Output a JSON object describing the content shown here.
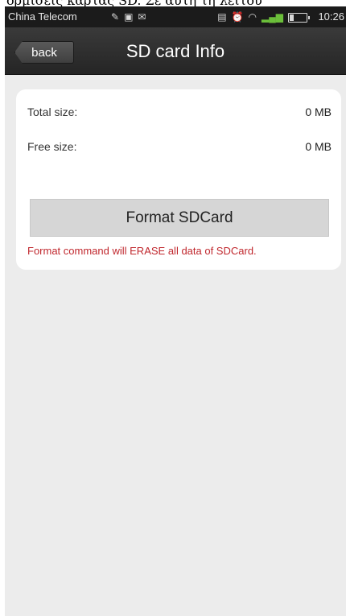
{
  "caption_fragment": "όρμισεις κάρτας SD. Σε αυτή τη λειτου",
  "status_bar": {
    "carrier": "China Telecom",
    "time": "10:26"
  },
  "header": {
    "back_label": "back",
    "title": "SD card Info"
  },
  "sd_info": {
    "total_label": "Total size:",
    "total_value": "0 MB",
    "free_label": "Free size:",
    "free_value": "0 MB"
  },
  "format": {
    "button_label": "Format SDCard",
    "warning": "Format command will ERASE all data of SDCard."
  },
  "colors": {
    "warning_text": "#c0272d",
    "titlebar": "#2e2e2e",
    "background": "#ececec"
  }
}
